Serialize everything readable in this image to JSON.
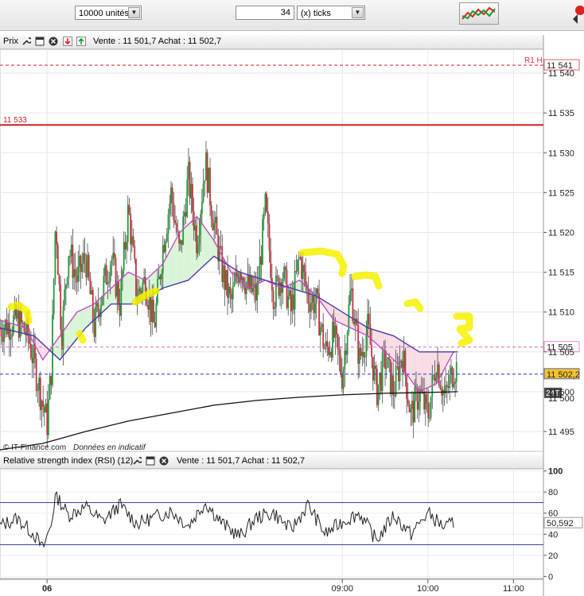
{
  "toolbar": {
    "units_value": "10000 unités",
    "ticks_value": "34",
    "ticks_type": "(x) ticks"
  },
  "price_panel": {
    "name": "Prix",
    "quote": "Vente : 11 501,7 Achat : 11 502,7",
    "copyright": "© IT-Finance.com",
    "disclaimer": "Données en indicatif"
  },
  "rsi_panel": {
    "name": "Relative strength index (RSI) (12)",
    "quote": "Vente : 11 501,7 Achat : 11 502,7",
    "current_value": "50,592"
  },
  "chart_data": [
    {
      "type": "candlestick",
      "ylim": [
        11492.5,
        11543
      ],
      "yticks": [
        "11 495",
        "11 500",
        "11 505",
        "11 510",
        "11 515",
        "11 520",
        "11 525",
        "11 530",
        "11 535",
        "11 540"
      ],
      "ytick_values": [
        11495,
        11500,
        11505,
        11510,
        11515,
        11520,
        11525,
        11530,
        11535,
        11540
      ],
      "xticks": [
        "06",
        "09:00",
        "10:00",
        "11:00"
      ],
      "xtick_values": [
        5.55,
        9.0,
        10.0,
        11.0
      ],
      "xlim": [
        5.0,
        11.35
      ],
      "levels": [
        {
          "label": "R1 H",
          "value": 11541,
          "value_label": "11 541",
          "style": "dashed",
          "color": "#e0333f"
        },
        {
          "label": "11 533",
          "value": 11533.5,
          "style": "solid",
          "color": "#cc2222"
        },
        {
          "label": "",
          "value": 11505.6,
          "value_label": "11 505",
          "style": "dashed",
          "color": "#e066c8"
        },
        {
          "label": "",
          "value": 11502.2,
          "value_label": "11 502,2",
          "style": "dashed",
          "color": "#3a4fb5"
        }
      ],
      "last_price_tag": "24T",
      "moving_average_long_tag": "11 500",
      "close_path": [
        [
          5.0,
          11508
        ],
        [
          5.2,
          11509
        ],
        [
          5.33,
          11507
        ],
        [
          5.45,
          11501
        ],
        [
          5.55,
          11496
        ],
        [
          5.6,
          11503
        ],
        [
          5.65,
          11522
        ],
        [
          5.72,
          11507
        ],
        [
          5.8,
          11518
        ],
        [
          5.9,
          11514
        ],
        [
          6.0,
          11517
        ],
        [
          6.1,
          11508
        ],
        [
          6.2,
          11513
        ],
        [
          6.3,
          11517
        ],
        [
          6.4,
          11511
        ],
        [
          6.5,
          11523
        ],
        [
          6.6,
          11512
        ],
        [
          6.7,
          11514
        ],
        [
          6.8,
          11508
        ],
        [
          6.9,
          11518
        ],
        [
          7.0,
          11525
        ],
        [
          7.1,
          11517
        ],
        [
          7.2,
          11527
        ],
        [
          7.3,
          11519
        ],
        [
          7.4,
          11529
        ],
        [
          7.5,
          11521
        ],
        [
          7.6,
          11515
        ],
        [
          7.7,
          11511
        ],
        [
          7.8,
          11516
        ],
        [
          7.9,
          11513
        ],
        [
          8.0,
          11512
        ],
        [
          8.1,
          11523
        ],
        [
          8.2,
          11512
        ],
        [
          8.3,
          11515
        ],
        [
          8.4,
          11510
        ],
        [
          8.5,
          11517
        ],
        [
          8.6,
          11512
        ],
        [
          8.7,
          11511
        ],
        [
          8.8,
          11505
        ],
        [
          8.9,
          11507
        ],
        [
          9.0,
          11502
        ],
        [
          9.1,
          11513
        ],
        [
          9.2,
          11504
        ],
        [
          9.3,
          11508
        ],
        [
          9.4,
          11500
        ],
        [
          9.5,
          11504
        ],
        [
          9.6,
          11500
        ],
        [
          9.7,
          11505
        ],
        [
          9.8,
          11497
        ],
        [
          9.9,
          11500
        ],
        [
          10.0,
          11497
        ],
        [
          10.1,
          11504
        ],
        [
          10.2,
          11499
        ],
        [
          10.3,
          11503
        ]
      ],
      "candle_high_low": [
        11513,
        11493
      ],
      "ma_short_path": [
        [
          5.0,
          11509
        ],
        [
          5.3,
          11508
        ],
        [
          5.5,
          11504
        ],
        [
          5.7,
          11507
        ],
        [
          5.9,
          11510
        ],
        [
          6.1,
          11511
        ],
        [
          6.3,
          11513
        ],
        [
          6.5,
          11515
        ],
        [
          6.7,
          11514
        ],
        [
          6.9,
          11516
        ],
        [
          7.1,
          11520
        ],
        [
          7.3,
          11522
        ],
        [
          7.5,
          11519
        ],
        [
          7.7,
          11515
        ],
        [
          7.9,
          11513
        ],
        [
          8.1,
          11514
        ],
        [
          8.3,
          11513
        ],
        [
          8.5,
          11514
        ],
        [
          8.7,
          11512
        ],
        [
          8.9,
          11509
        ],
        [
          9.1,
          11508
        ],
        [
          9.3,
          11507
        ],
        [
          9.5,
          11505
        ],
        [
          9.7,
          11503
        ],
        [
          9.9,
          11500
        ],
        [
          10.1,
          11501
        ],
        [
          10.3,
          11505
        ]
      ],
      "ma_mid_path": [
        [
          5.0,
          11508
        ],
        [
          5.4,
          11507
        ],
        [
          5.7,
          11504
        ],
        [
          6.0,
          11508
        ],
        [
          6.3,
          11511
        ],
        [
          6.6,
          11511
        ],
        [
          6.9,
          11513
        ],
        [
          7.2,
          11514
        ],
        [
          7.5,
          11517
        ],
        [
          7.8,
          11515
        ],
        [
          8.1,
          11514
        ],
        [
          8.4,
          11513
        ],
        [
          8.7,
          11512
        ],
        [
          9.0,
          11510
        ],
        [
          9.3,
          11508
        ],
        [
          9.6,
          11507
        ],
        [
          9.9,
          11505
        ],
        [
          10.2,
          11505
        ],
        [
          10.35,
          11505
        ]
      ],
      "ma_long_path": [
        [
          5.0,
          11492.7
        ],
        [
          5.5,
          11493.5
        ],
        [
          6.0,
          11495
        ],
        [
          6.5,
          11496.3
        ],
        [
          7.0,
          11497.3
        ],
        [
          7.5,
          11498.3
        ],
        [
          8.0,
          11498.9
        ],
        [
          8.5,
          11499.3
        ],
        [
          9.0,
          11499.6
        ],
        [
          9.5,
          11499.8
        ],
        [
          10.0,
          11499.9
        ],
        [
          10.35,
          11500
        ]
      ]
    },
    {
      "type": "line",
      "title": "Relative strength index (RSI) (12)",
      "ylim": [
        -2,
        102
      ],
      "yticks": [
        "0",
        "20",
        "40",
        "60",
        "80",
        "100"
      ],
      "ytick_values": [
        0,
        20,
        40,
        60,
        80,
        100
      ],
      "bands": [
        30,
        70
      ],
      "values_path": [
        [
          5.0,
          48
        ],
        [
          5.2,
          55
        ],
        [
          5.4,
          40
        ],
        [
          5.5,
          26
        ],
        [
          5.6,
          50
        ],
        [
          5.65,
          78
        ],
        [
          5.8,
          58
        ],
        [
          6.0,
          66
        ],
        [
          6.2,
          52
        ],
        [
          6.4,
          68
        ],
        [
          6.6,
          50
        ],
        [
          6.8,
          56
        ],
        [
          7.0,
          62
        ],
        [
          7.2,
          48
        ],
        [
          7.4,
          70
        ],
        [
          7.6,
          50
        ],
        [
          7.8,
          38
        ],
        [
          8.0,
          56
        ],
        [
          8.2,
          60
        ],
        [
          8.4,
          44
        ],
        [
          8.6,
          68
        ],
        [
          8.8,
          40
        ],
        [
          9.0,
          52
        ],
        [
          9.2,
          60
        ],
        [
          9.4,
          34
        ],
        [
          9.6,
          58
        ],
        [
          9.8,
          40
        ],
        [
          10.0,
          60
        ],
        [
          10.2,
          46
        ],
        [
          10.3,
          51
        ]
      ]
    }
  ]
}
